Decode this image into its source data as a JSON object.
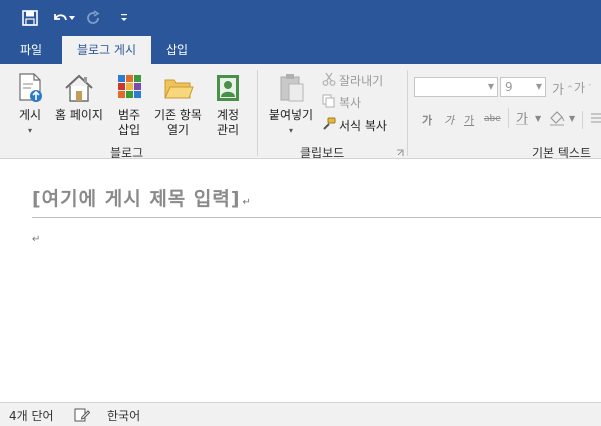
{
  "quick_access": {
    "save_icon": "save-icon",
    "undo_icon": "undo-icon",
    "redo_icon": "redo-icon",
    "customize_icon": "customize-qat-icon"
  },
  "tabs": [
    {
      "label": "파일",
      "active": false
    },
    {
      "label": "블로그 게시",
      "active": true
    },
    {
      "label": "삽입",
      "active": false
    }
  ],
  "ribbon": {
    "blog_group": {
      "label": "블로그",
      "buttons": [
        {
          "label_line1": "게시",
          "label_line2": "▾",
          "icon": "publish-icon"
        },
        {
          "label_line1": "홈 페이지",
          "label_line2": "",
          "icon": "home-icon"
        },
        {
          "label_line1": "범주",
          "label_line2": "삽입",
          "icon": "category-icon"
        },
        {
          "label_line1": "기존 항목",
          "label_line2": "열기",
          "icon": "open-folder-icon"
        },
        {
          "label_line1": "계정",
          "label_line2": "관리",
          "icon": "account-icon"
        }
      ]
    },
    "clipboard_group": {
      "label": "클립보드",
      "paste": {
        "label_line1": "붙여넣기",
        "label_line2": "▾"
      },
      "cut": "잘라내기",
      "copy": "복사",
      "format_painter": "서식 복사"
    },
    "basic_text_group": {
      "label": "기본 텍스트",
      "font_name": "",
      "font_size": "9",
      "grow_font": "가",
      "shrink_font": "가",
      "bold": "가",
      "italic": "가",
      "underline": "가",
      "strikethrough": "abe",
      "font_color": "가"
    }
  },
  "document": {
    "title_placeholder": "[여기에 게시 제목 입력]",
    "title_mark": "↵",
    "body_mark": "↵"
  },
  "status_bar": {
    "word_count": "4개 단어",
    "language": "한국어"
  },
  "colors": {
    "accent": "#2b579a",
    "ribbon_bg": "#f1f1f1",
    "title_text": "#8a8a8a"
  }
}
